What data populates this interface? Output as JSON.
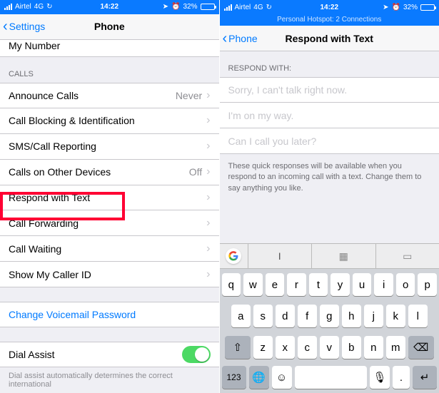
{
  "status": {
    "carrier": "Airtel",
    "network": "4G",
    "time": "14:22",
    "battery_pct": "32%"
  },
  "hotspot_banner": "Personal Hotspot: 2 Connections",
  "left": {
    "back_label": "Settings",
    "title": "Phone",
    "my_number_label": "My Number",
    "my_number_value": "",
    "calls_header": "CALLS",
    "cells": {
      "announce": {
        "label": "Announce Calls",
        "value": "Never"
      },
      "blocking": {
        "label": "Call Blocking & Identification"
      },
      "sms": {
        "label": "SMS/Call Reporting"
      },
      "other": {
        "label": "Calls on Other Devices",
        "value": "Off"
      },
      "respond": {
        "label": "Respond with Text"
      },
      "forwarding": {
        "label": "Call Forwarding"
      },
      "waiting": {
        "label": "Call Waiting"
      },
      "callerid": {
        "label": "Show My Caller ID"
      },
      "voicemail": {
        "label": "Change Voicemail Password"
      },
      "dial_assist": {
        "label": "Dial Assist"
      }
    },
    "dial_assist_footer": "Dial assist automatically determines the correct international"
  },
  "right": {
    "back_label": "Phone",
    "title": "Respond with Text",
    "section_header": "RESPOND WITH:",
    "fields": [
      "Sorry, I can't talk right now.",
      "I'm on my way.",
      "Can I call you later?"
    ],
    "footer": "These quick responses will be available when you respond to an incoming call with a text. Change them to say anything you like."
  },
  "keyboard": {
    "suggestions": [
      "I",
      "",
      ""
    ],
    "row1": [
      "q",
      "w",
      "e",
      "r",
      "t",
      "y",
      "u",
      "i",
      "o",
      "p"
    ],
    "row2": [
      "a",
      "s",
      "d",
      "f",
      "g",
      "h",
      "j",
      "k",
      "l"
    ],
    "row3": [
      "z",
      "x",
      "c",
      "v",
      "b",
      "n",
      "m"
    ],
    "k123": "123",
    "dot": "."
  }
}
